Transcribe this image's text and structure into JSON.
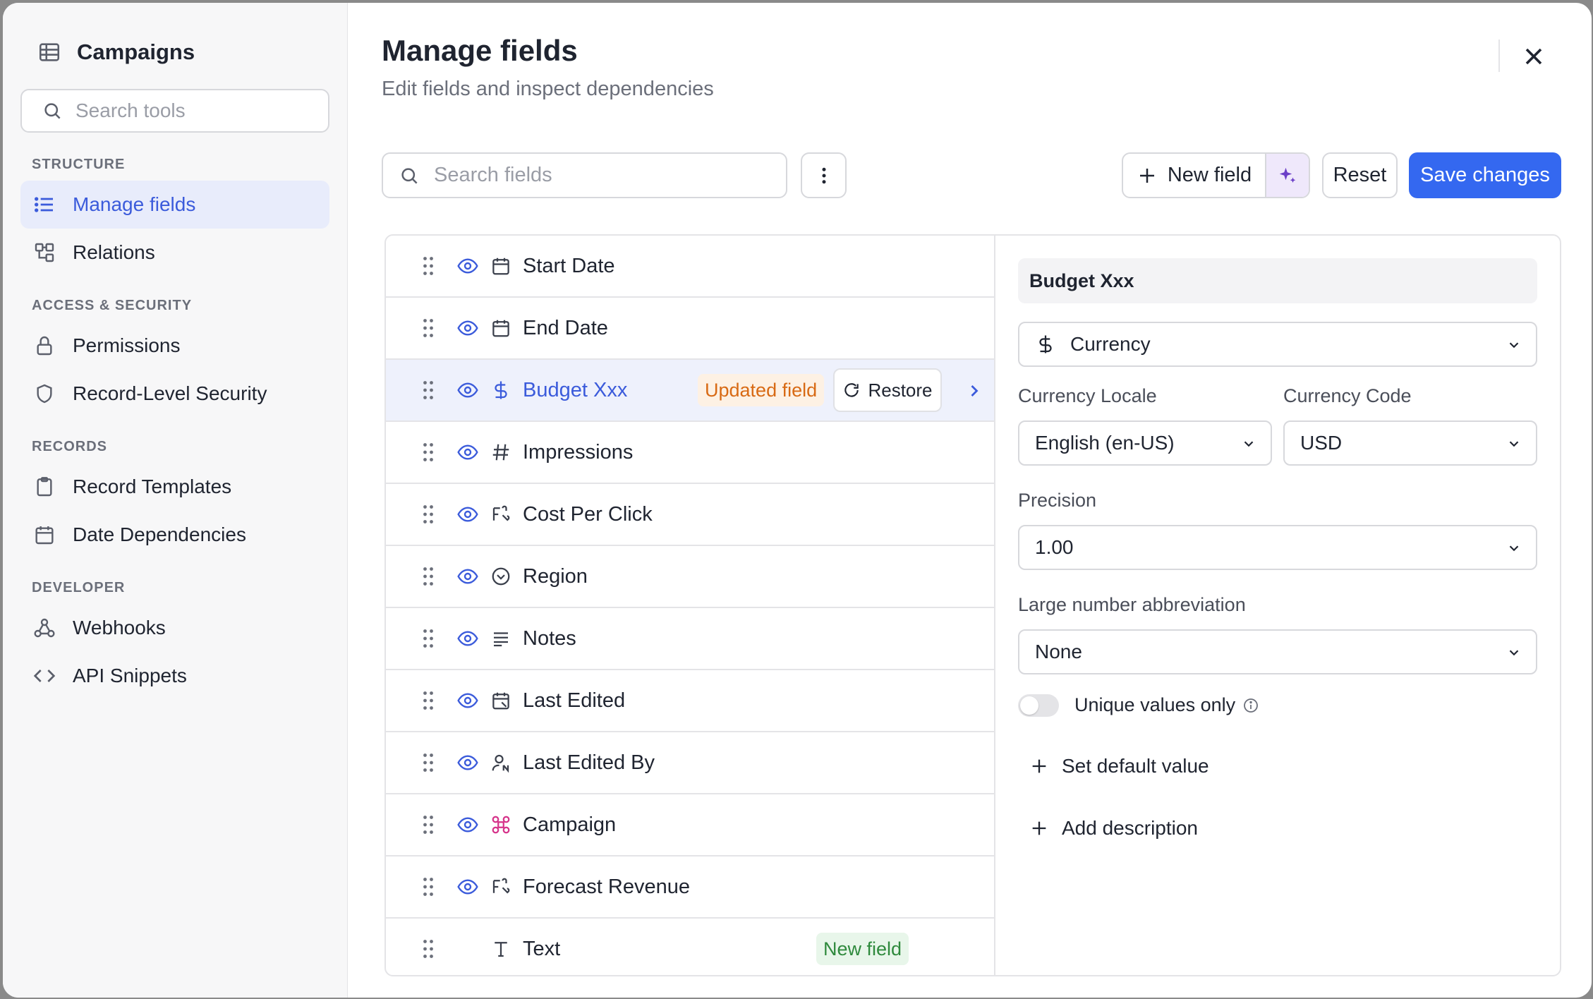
{
  "sidebar": {
    "title": "Campaigns",
    "search_placeholder": "Search tools",
    "sections": {
      "structure": "STRUCTURE",
      "access": "ACCESS & SECURITY",
      "records": "RECORDS",
      "developer": "DEVELOPER"
    },
    "items": {
      "manage_fields": "Manage fields",
      "relations": "Relations",
      "permissions": "Permissions",
      "rls": "Record-Level Security",
      "record_templates": "Record Templates",
      "date_dependencies": "Date Dependencies",
      "webhooks": "Webhooks",
      "api_snippets": "API Snippets"
    }
  },
  "header": {
    "title": "Manage fields",
    "subtitle": "Edit fields and inspect dependencies"
  },
  "toolbar": {
    "search_placeholder": "Search fields",
    "new_field_label": "New field",
    "reset_label": "Reset",
    "save_label": "Save changes"
  },
  "fields": [
    {
      "name": "Start Date",
      "icon": "calendar-icon"
    },
    {
      "name": "End Date",
      "icon": "calendar-icon"
    },
    {
      "name": "Budget Xxx",
      "icon": "dollar-icon",
      "badge": "Updated field",
      "action": "Restore"
    },
    {
      "name": "Impressions",
      "icon": "hash-icon"
    },
    {
      "name": "Cost Per Click",
      "icon": "formula-icon"
    },
    {
      "name": "Region",
      "icon": "select-icon"
    },
    {
      "name": "Notes",
      "icon": "long-text-icon"
    },
    {
      "name": "Last Edited",
      "icon": "calendar-edit-icon"
    },
    {
      "name": "Last Edited By",
      "icon": "user-edit-icon"
    },
    {
      "name": "Campaign",
      "icon": "link-icon"
    },
    {
      "name": "Forecast Revenue",
      "icon": "formula-icon"
    },
    {
      "name": "Text",
      "icon": "text-icon",
      "badge": "New field"
    }
  ],
  "detail": {
    "field_name": "Budget Xxx",
    "field_type": "Currency",
    "currency_locale_label": "Currency Locale",
    "currency_locale_value": "English (en-US)",
    "currency_code_label": "Currency Code",
    "currency_code_value": "USD",
    "precision_label": "Precision",
    "precision_value": "1.00",
    "abbreviation_label": "Large number abbreviation",
    "abbreviation_value": "None",
    "unique_label": "Unique values only",
    "set_default_label": "Set default value",
    "add_description_label": "Add description"
  },
  "colors": {
    "accent": "#3468f0",
    "updated_badge": "#d86a14",
    "new_badge": "#2f8a3d"
  }
}
